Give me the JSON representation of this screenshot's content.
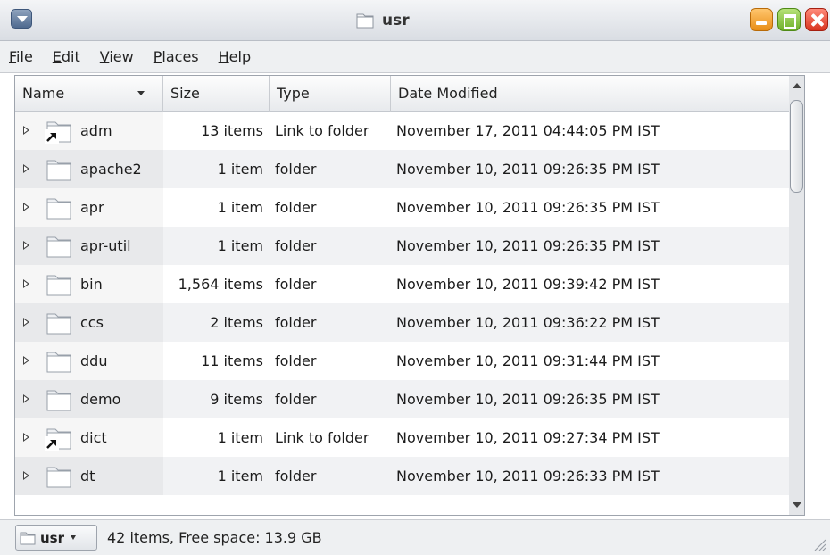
{
  "window": {
    "title": "usr",
    "icons": {
      "menu": "window-menu-icon",
      "folder": "folder-icon",
      "minimize": "minimize-icon",
      "maximize": "maximize-icon",
      "close": "close-icon"
    }
  },
  "menubar": {
    "items": [
      {
        "mnemonic": "F",
        "rest": "ile"
      },
      {
        "mnemonic": "E",
        "rest": "dit"
      },
      {
        "mnemonic": "V",
        "rest": "iew"
      },
      {
        "mnemonic": "P",
        "rest": "laces"
      },
      {
        "mnemonic": "H",
        "rest": "elp"
      }
    ]
  },
  "table": {
    "columns": {
      "name": "Name",
      "size": "Size",
      "type": "Type",
      "date": "Date Modified"
    },
    "rows": [
      {
        "name": "adm",
        "size": "13 items",
        "type": "Link to folder",
        "date": "November 17, 2011 04:44:05 PM IST",
        "icon": "folder-link-icon"
      },
      {
        "name": "apache2",
        "size": "1 item",
        "type": "folder",
        "date": "November 10, 2011 09:26:35 PM IST",
        "icon": "folder-icon"
      },
      {
        "name": "apr",
        "size": "1 item",
        "type": "folder",
        "date": "November 10, 2011 09:26:35 PM IST",
        "icon": "folder-icon"
      },
      {
        "name": "apr-util",
        "size": "1 item",
        "type": "folder",
        "date": "November 10, 2011 09:26:35 PM IST",
        "icon": "folder-icon"
      },
      {
        "name": "bin",
        "size": "1,564 items",
        "type": "folder",
        "date": "November 10, 2011 09:39:42 PM IST",
        "icon": "folder-icon"
      },
      {
        "name": "ccs",
        "size": "2 items",
        "type": "folder",
        "date": "November 10, 2011 09:36:22 PM IST",
        "icon": "folder-icon"
      },
      {
        "name": "ddu",
        "size": "11 items",
        "type": "folder",
        "date": "November 10, 2011 09:31:44 PM IST",
        "icon": "folder-icon"
      },
      {
        "name": "demo",
        "size": "9 items",
        "type": "folder",
        "date": "November 10, 2011 09:26:35 PM IST",
        "icon": "folder-icon"
      },
      {
        "name": "dict",
        "size": "1 item",
        "type": "Link to folder",
        "date": "November 10, 2011 09:27:34 PM IST",
        "icon": "folder-link-icon"
      },
      {
        "name": "dt",
        "size": "1 item",
        "type": "folder",
        "date": "November 10, 2011 09:26:33 PM IST",
        "icon": "folder-icon"
      }
    ]
  },
  "statusbar": {
    "location": "usr",
    "text": "42 items, Free space: 13.9 GB"
  },
  "colors": {
    "header_bg": "#e8eaed",
    "alt_row": "#f1f2f4",
    "minimize": "#e88d16",
    "maximize": "#6fb02a",
    "close": "#d8341f"
  }
}
